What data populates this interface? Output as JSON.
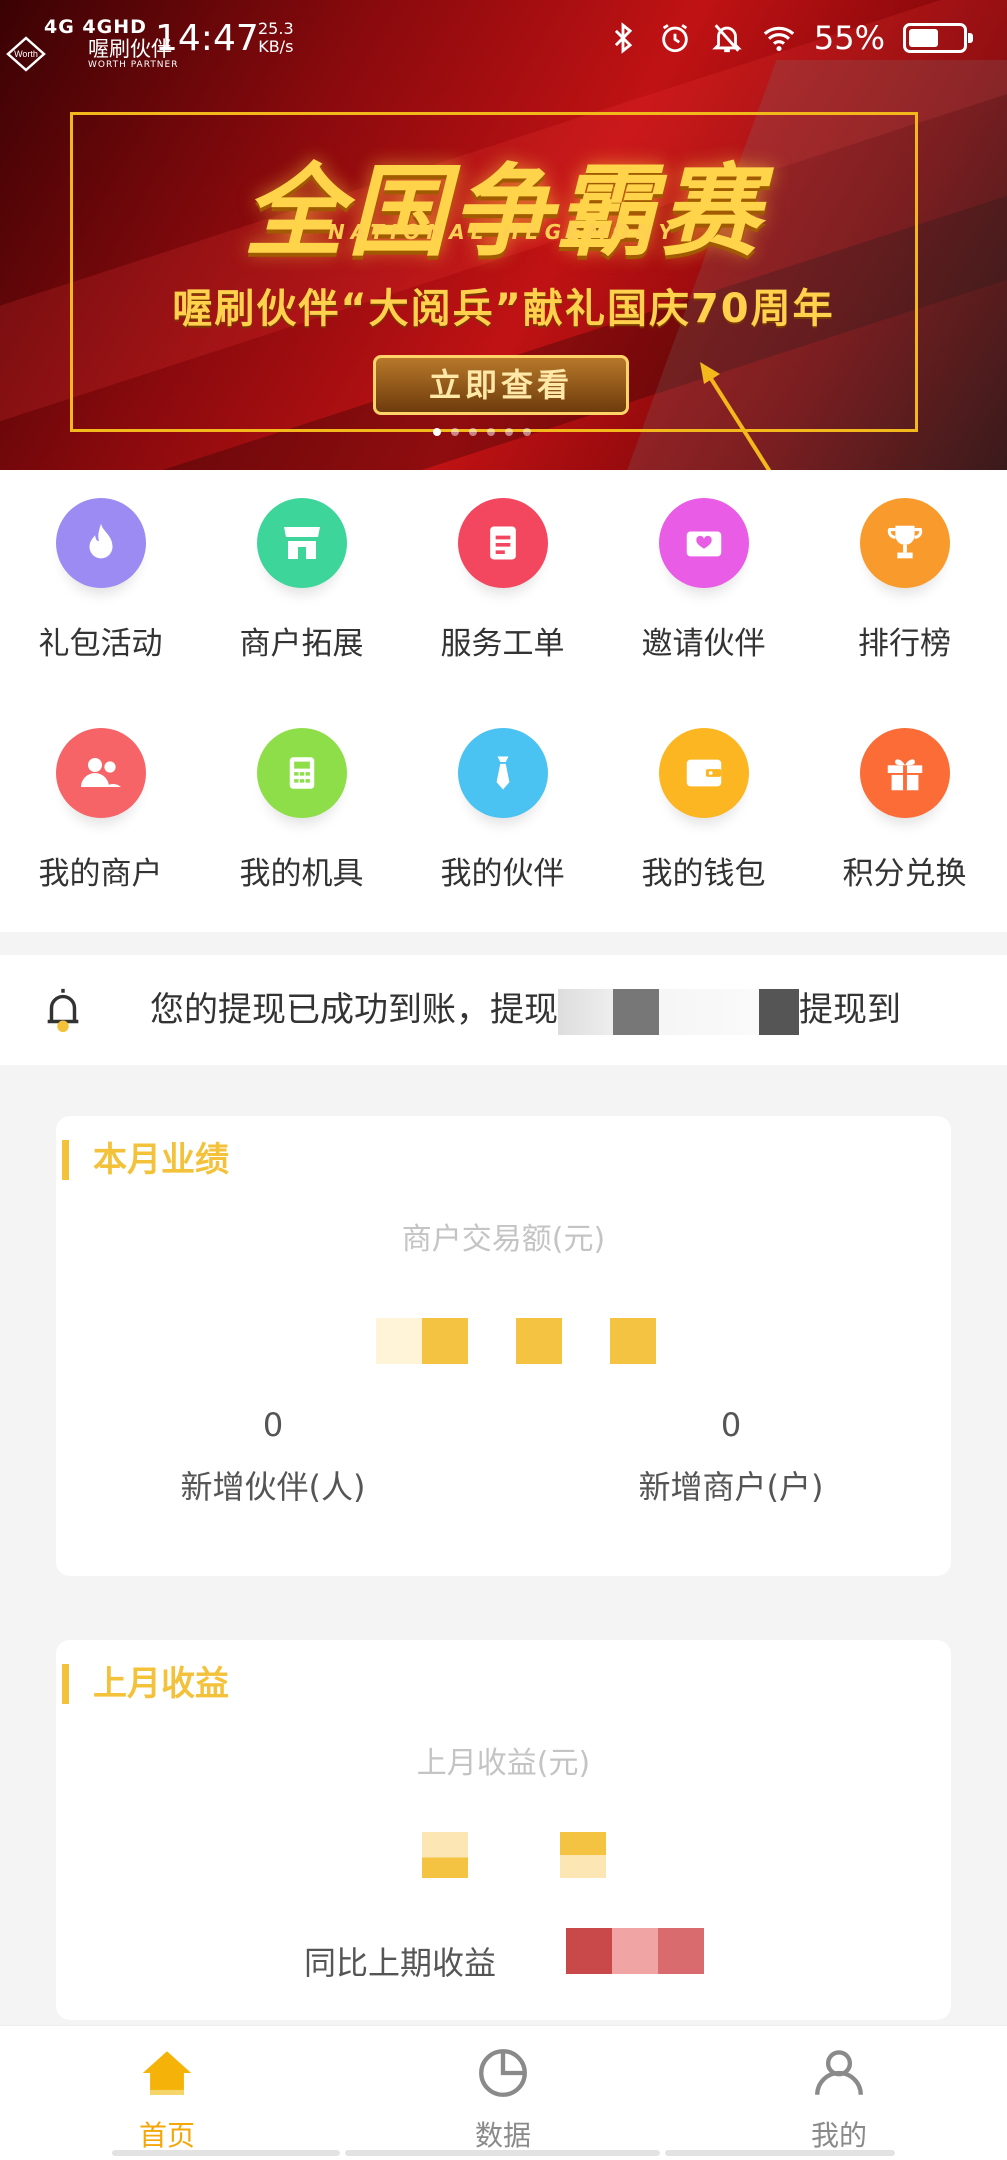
{
  "status_bar": {
    "network": "4G 4GHD",
    "time": "14:47",
    "speed_value": "25.3",
    "speed_unit": "KB/s",
    "battery_percent": "55%",
    "battery_level": 0.55
  },
  "logo": {
    "title": "喔刷伙伴",
    "subtitle": "WORTH PARTNER",
    "mark_text": "Worth"
  },
  "banner": {
    "title": "全国争霸赛",
    "subtitle": "NATIONAL HEGEMONY",
    "tagline": "喔刷伙伴“大阅兵”献礼国庆70周年",
    "button": "立即查看",
    "slide_count": 6,
    "active_slide": 0
  },
  "menu": [
    {
      "label": "礼包活动",
      "icon": "fire-icon",
      "color": "#9c8bf2"
    },
    {
      "label": "商户拓展",
      "icon": "store-icon",
      "color": "#3ed59b"
    },
    {
      "label": "服务工单",
      "icon": "document-icon",
      "color": "#f2475f"
    },
    {
      "label": "邀请伙伴",
      "icon": "envelope-heart-icon",
      "color": "#e85ce6"
    },
    {
      "label": "排行榜",
      "icon": "trophy-icon",
      "color": "#f99b2c"
    },
    {
      "label": "我的商户",
      "icon": "users-icon",
      "color": "#f66468"
    },
    {
      "label": "我的机具",
      "icon": "calculator-icon",
      "color": "#8dde49"
    },
    {
      "label": "我的伙伴",
      "icon": "tie-icon",
      "color": "#4bc3f2"
    },
    {
      "label": "我的钱包",
      "icon": "wallet-icon",
      "color": "#fbb622"
    },
    {
      "label": "积分兑换",
      "icon": "gift-icon",
      "color": "#fb6c36"
    }
  ],
  "notice": {
    "icon": "bell-icon",
    "text_start": "您的提现已成功到账，提现",
    "text_end": "提现到"
  },
  "this_month": {
    "title": "本月业绩",
    "amount_label": "商户交易额(元)",
    "stats": [
      {
        "value": "0",
        "label": "新增伙伴(人)"
      },
      {
        "value": "0",
        "label": "新增商户(户)"
      }
    ]
  },
  "last_month": {
    "title": "上月收益",
    "amount_label": "上月收益(元)",
    "compare_label": "同比上期收益"
  },
  "tabs": [
    {
      "label": "首页",
      "icon": "home-icon",
      "active": true
    },
    {
      "label": "数据",
      "icon": "pie-chart-icon",
      "active": false
    },
    {
      "label": "我的",
      "icon": "user-icon",
      "active": false
    }
  ],
  "colors": {
    "accent": "#f3c23a",
    "active_tab": "#f5a70a",
    "banner_red": "#c01214",
    "frame_gold": "#f2b81c"
  }
}
